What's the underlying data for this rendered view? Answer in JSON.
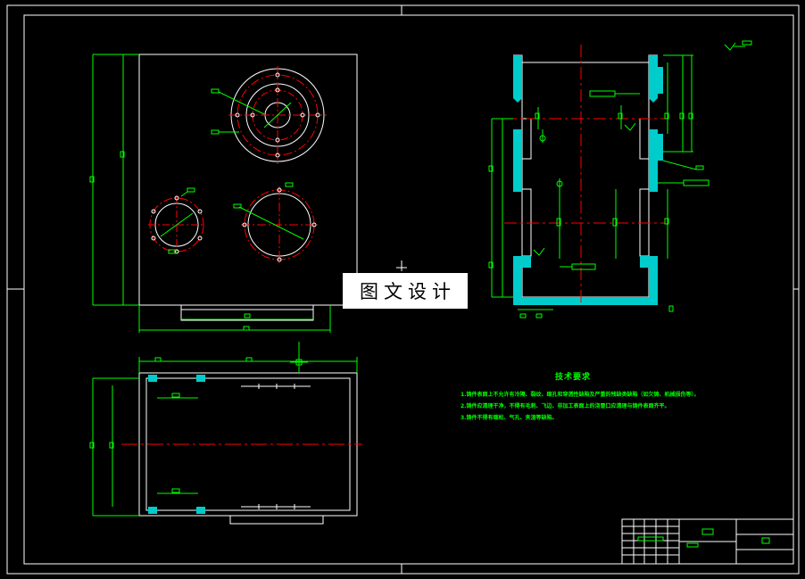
{
  "watermark": {
    "text": "图文设计"
  },
  "technical_requirements": {
    "title": "技术要求",
    "notes": [
      "1.铸件表面上不允许有冷隔、裂纹、缩孔和穿透性缺陷及严重的残缺类缺陷（如欠铸、机械损伤等）。",
      "2.铸件应清理干净，不得有毛刺、飞边、非加工表面上的浇冒口应清理与铸件表面齐平。",
      "3.铸件不得有缩松、气孔、夹渣等缺陷。"
    ]
  },
  "colors": {
    "background": "#000000",
    "outline": "#ffffff",
    "dimension": "#00ff00",
    "centerline": "#ff0000",
    "hatch": "#00cccc"
  }
}
